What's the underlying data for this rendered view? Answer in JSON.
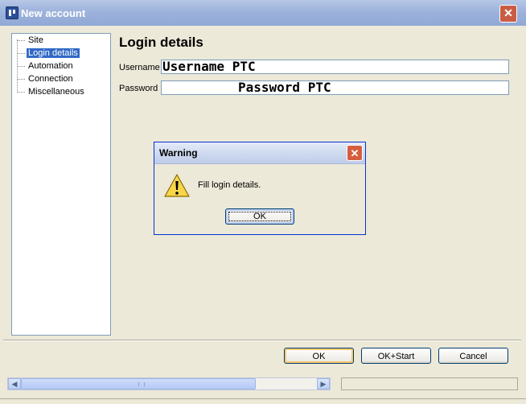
{
  "window": {
    "title": "New account",
    "close_icon": "close-icon",
    "app_icon": "app-icon"
  },
  "tree": {
    "items": [
      {
        "label": "Site",
        "selected": false
      },
      {
        "label": "Login details",
        "selected": true
      },
      {
        "label": "Automation",
        "selected": false
      },
      {
        "label": "Connection",
        "selected": false
      },
      {
        "label": "Miscellaneous",
        "selected": false
      }
    ]
  },
  "form": {
    "title": "Login details",
    "username_label": "Username",
    "username_value": "Username PTC",
    "password_label": "Password",
    "password_value": "Password PTC"
  },
  "buttons": {
    "ok": "OK",
    "ok_start": "OK+Start",
    "cancel": "Cancel"
  },
  "dialog": {
    "title": "Warning",
    "message": "Fill login details.",
    "ok": "OK",
    "icon": "warning-icon"
  },
  "colors": {
    "title_bar": "#9db3dc",
    "selection": "#316ac5",
    "dialog_border": "#0831d9"
  }
}
